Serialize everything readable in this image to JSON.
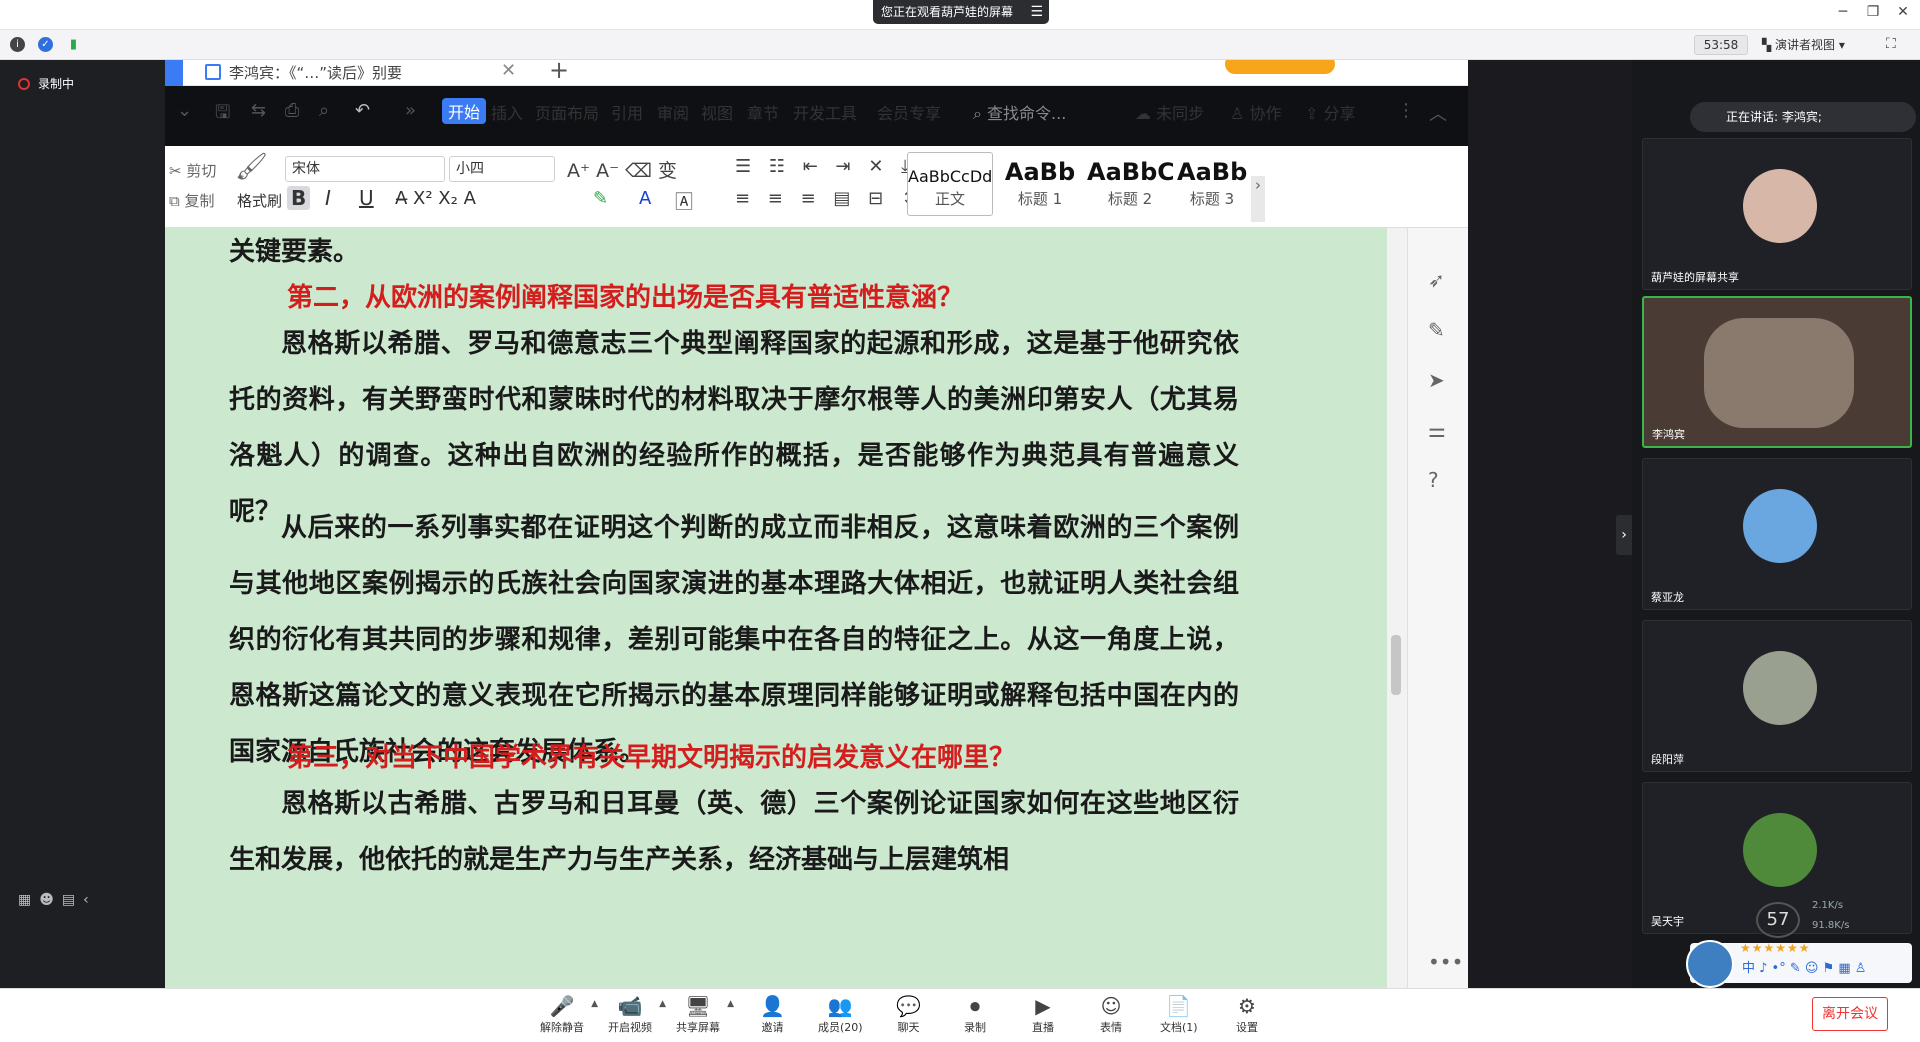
{
  "titlebar": {
    "banner": "您正在观看葫芦娃的屏幕",
    "banner_menu": "☰",
    "minimize": "─",
    "restore": "❐",
    "close": "✕"
  },
  "infobar": {
    "timer": "53:58",
    "view_mode": "演讲者视图"
  },
  "left": {
    "recording_label": "录制中"
  },
  "doc": {
    "title": "李鸿宾：《“…”读后》别要",
    "menu_tabs": [
      "开始",
      "插入",
      "页面布局",
      "引用",
      "审阅",
      "视图",
      "章节",
      "开发工具",
      "会员专享"
    ],
    "search_placeholder": "查找命令...",
    "sync": "未同步",
    "collab": "协作",
    "share": "分享",
    "ribbon": {
      "cut": "剪切",
      "copy": "复制",
      "format_painter": "格式刷",
      "font": "宋体",
      "size": "小四",
      "styles": [
        {
          "preview": "AaBbCcDd",
          "name": "正文"
        },
        {
          "preview": "AaBb",
          "name": "标题 1"
        },
        {
          "preview": "AaBbC",
          "name": "标题 2"
        },
        {
          "preview": "AaBbC",
          "name": "标题 3"
        }
      ]
    },
    "paragraphs": [
      {
        "text": "关键要素。",
        "heading": false
      },
      {
        "text": "第二，从欧洲的案例阐释国家的出场是否具有普适性意涵？",
        "heading": true
      },
      {
        "text": "恩格斯以希腊、罗马和德意志三个典型阐释国家的起源和形成，这是基于他研究依托的资料，有关野蛮时代和蒙昧时代的材料取决于摩尔根等人的美洲印第安人（尤其易洛魁人）的调查。这种出自欧洲的经验所作的概括，是否能够作为典范具有普遍意义呢？",
        "heading": false
      },
      {
        "text": "从后来的一系列事实都在证明这个判断的成立而非相反，这意味着欧洲的三个案例与其他地区案例揭示的氏族社会向国家演进的基本理路大体相近，也就证明人类社会组织的衍化有其共同的步骤和规律，差别可能集中在各自的特征之上。从这一角度上说，恩格斯这篇论文的意义表现在它所揭示的基本原理同样能够证明或解释包括中国在内的国家源自氏族社会的这套发展体系。",
        "heading": false
      },
      {
        "text": "第三，对当下中国学术界有关早期文明揭示的启发意义在哪里？",
        "heading": true
      },
      {
        "text": "恩格斯以古希腊、古罗马和日耳曼（英、德）三个案例论证国家如何在这些地区衍生和发展，他依托的就是生产力与生产关系，经济基础与上层建筑相",
        "heading": false
      }
    ]
  },
  "panel": {
    "speaking_label": "正在讲话: 李鸿宾;",
    "participants": [
      {
        "name": "葫芦娃的屏幕共享",
        "color": "#d7b8a8"
      },
      {
        "name": "李鸿宾",
        "color": "#8a7a6e"
      },
      {
        "name": "蔡亚龙",
        "color": "#6aa6e0"
      },
      {
        "name": "段阳萍",
        "color": "#9aa090"
      },
      {
        "name": "吴天宇",
        "color": "#4f8a3a"
      }
    ],
    "percent": "57",
    "upload": "2.1K/s",
    "download": "91.8K/s",
    "ime_text": "中 ♪ •° ✎ ☺ ⚑ ▦ ♙"
  },
  "toolbar": {
    "items": [
      {
        "icon": "🎤",
        "label": "解除静音",
        "caret": true
      },
      {
        "icon": "📹",
        "label": "开启视频",
        "caret": true
      },
      {
        "icon": "🖥",
        "label": "共享屏幕",
        "caret": true
      },
      {
        "icon": "👤",
        "label": "邀请",
        "caret": false
      },
      {
        "icon": "👥",
        "label": "成员(20)",
        "caret": false
      },
      {
        "icon": "💬",
        "label": "聊天",
        "caret": false
      },
      {
        "icon": "⏺",
        "label": "录制",
        "caret": false
      },
      {
        "icon": "▶",
        "label": "直播",
        "caret": false
      },
      {
        "icon": "☺",
        "label": "表情",
        "caret": false
      },
      {
        "icon": "📄",
        "label": "文档(1)",
        "caret": false
      },
      {
        "icon": "⚙",
        "label": "设置",
        "caret": false
      }
    ],
    "leave": "离开会议"
  }
}
